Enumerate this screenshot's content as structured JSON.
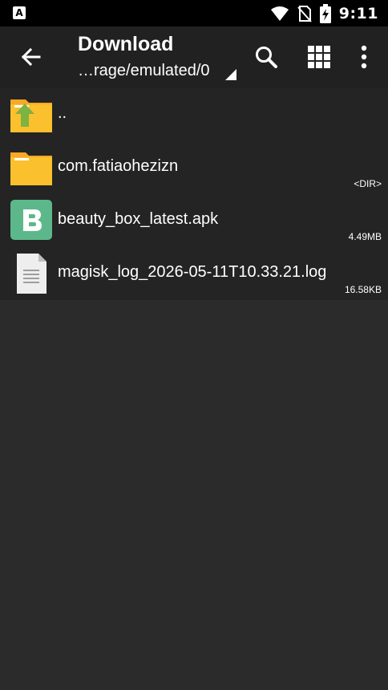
{
  "status_bar": {
    "time": "9:11",
    "left_icon_letter": "A",
    "icons": [
      "notification-a-icon",
      "wifi-icon",
      "no-sim-icon",
      "battery-charging-icon"
    ]
  },
  "toolbar": {
    "title": "Download",
    "path": "…rage/emulated/0",
    "actions": [
      "back-arrow-icon",
      "search-icon",
      "grid-view-icon",
      "more-vert-icon"
    ]
  },
  "files": [
    {
      "name": "..",
      "meta": "",
      "icon": "parent-folder-icon"
    },
    {
      "name": "com.fatiaohezizn",
      "meta": "<DIR>",
      "icon": "folder-icon"
    },
    {
      "name": "beauty_box_latest.apk",
      "meta": "4.49MB",
      "icon": "apk-icon"
    },
    {
      "name": "magisk_log_2026-05-11T10.33.21.log",
      "meta": "16.58KB",
      "icon": "text-file-icon"
    }
  ],
  "colors": {
    "background": "#2b2b2b",
    "toolbar": "#212121",
    "folder": "#f9a825",
    "apk": "#5cb88a",
    "up_arrow": "#7cb342"
  }
}
